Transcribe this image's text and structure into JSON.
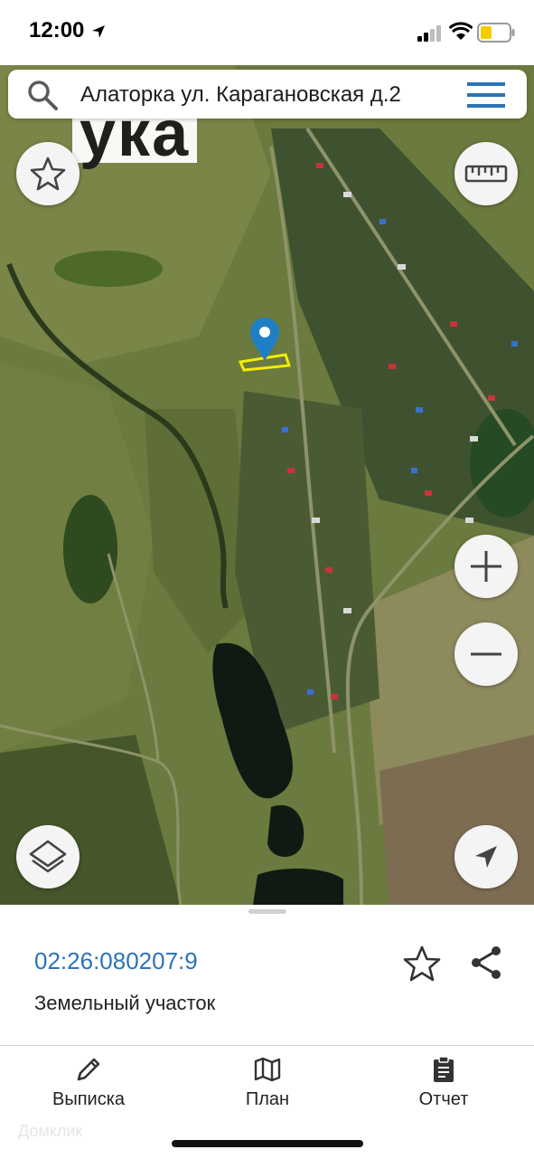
{
  "status_bar": {
    "time": "12:00"
  },
  "search": {
    "query": "Алаторка ул. Карагановская д.2"
  },
  "map": {
    "label_fragment": "ука"
  },
  "buttons": {
    "favorite": "star-icon",
    "ruler": "ruler-icon",
    "zoom_in": "plus-icon",
    "zoom_out": "minus-icon",
    "layers": "layers-icon",
    "locate": "navigation-arrow-icon"
  },
  "result": {
    "cadastral_number": "02:26:080207:9",
    "object_type": "Земельный участок"
  },
  "bottom_nav": {
    "items": [
      {
        "label": "Выписка",
        "icon": "pencil-icon"
      },
      {
        "label": "План",
        "icon": "map-icon"
      },
      {
        "label": "Отчет",
        "icon": "clipboard-icon"
      }
    ]
  },
  "watermark": "Домклик",
  "colors": {
    "accent": "#2b73b8",
    "marker": "#1f7fc4",
    "parcel_outline": "#f2ee00"
  }
}
